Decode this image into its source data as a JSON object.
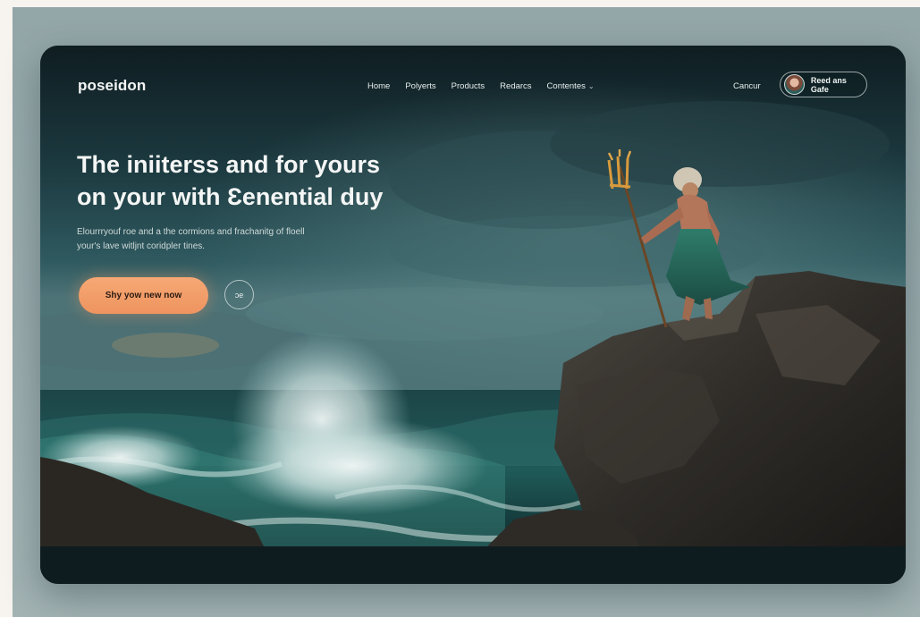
{
  "brand": {
    "logo": "poseidon"
  },
  "nav": {
    "items": [
      {
        "label": "Home"
      },
      {
        "label": "Polyerts"
      },
      {
        "label": "Products"
      },
      {
        "label": "Redarcs"
      },
      {
        "label": "Contentes",
        "chevron": "chevron-down-icon"
      }
    ],
    "signin": "Cancur",
    "profile_name": "Reed ans Gafe"
  },
  "hero": {
    "headline_line1": "The iniiterss and for yours",
    "headline_line2": "on your with Ɛenential duy",
    "sub_line1": "Elourrryouf roe and a the cormions and frachanitg of floell",
    "sub_line2": "your's lave witljnt coridpler tines.",
    "cta_label": "Shy yow new now",
    "secondary_label": "ɔe"
  },
  "colors": {
    "accent": "#f09a66",
    "background": "#14252a",
    "page": "#f7f3ef",
    "backdrop": "#9aacae"
  }
}
